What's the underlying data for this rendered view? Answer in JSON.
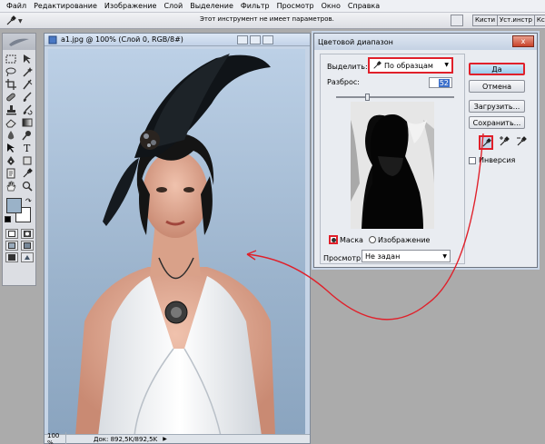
{
  "menubar": {
    "items": [
      "Файл",
      "Редактирование",
      "Изображение",
      "Слой",
      "Выделение",
      "Фильтр",
      "Просмотр",
      "Окно",
      "Справка"
    ]
  },
  "optionsbar": {
    "tool_icon": "eyedropper-icon",
    "message": "Этот инструмент не имеет параметров.",
    "panel_tabs": [
      "Кисти",
      "Уст.инстр",
      "Кс"
    ]
  },
  "toolbox": {
    "foreground_color": "#9ab2c8",
    "background_color": "#ffffff"
  },
  "document": {
    "title": "a1.jpg @ 100% (Слой 0, RGB/8#)",
    "zoom": "100 %",
    "status": "Док: 892,5K/892,5K"
  },
  "dialog": {
    "title": "Цветовой диапазон",
    "close_label": "x",
    "select_label": "Выделить:",
    "select_value": "По образцам",
    "fuzziness_label": "Разброс:",
    "fuzziness_value": "52",
    "fuzziness_level_percent": 26,
    "radio_mask": "Маска",
    "radio_image": "Изображение",
    "selected_radio": "Маска",
    "preview_label": "Просмотр:",
    "preview_value": "Не задан",
    "buttons": {
      "ok": "Да",
      "cancel": "Отмена",
      "load": "Загрузить...",
      "save": "Сохранить..."
    },
    "invert_label": "Инверсия",
    "invert_checked": false
  },
  "highlight_color": "#e0202a"
}
